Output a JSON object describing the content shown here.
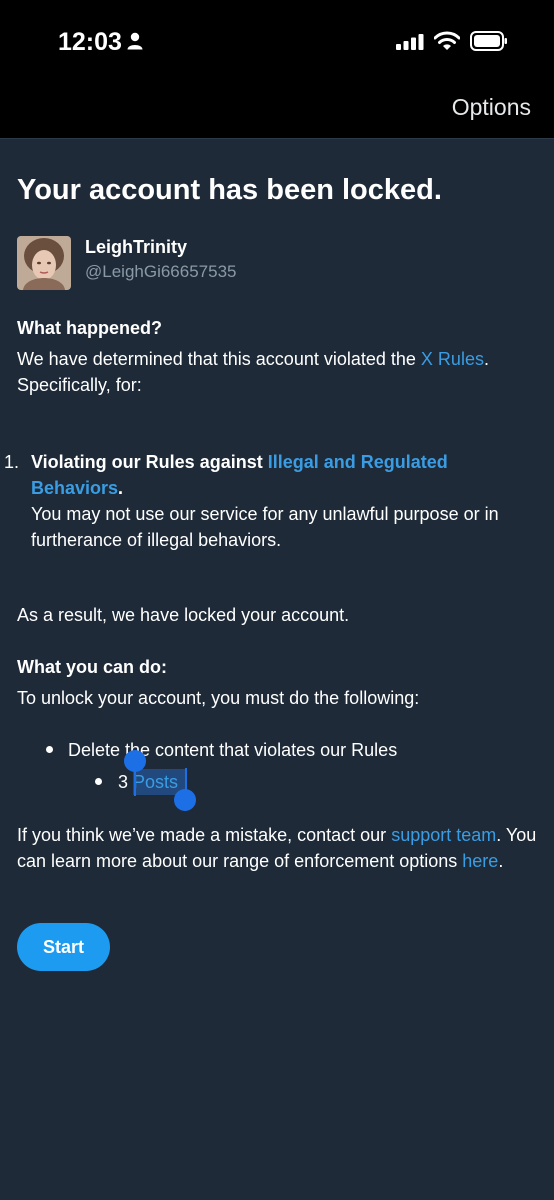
{
  "status_bar": {
    "time": "12:03"
  },
  "top_bar": {
    "options_label": "Options"
  },
  "page": {
    "title": "Your account has been locked.",
    "user": {
      "name": "LeighTrinity",
      "handle": "@LeighGi66657535"
    },
    "what_happened": {
      "heading": "What happened?",
      "text_before_link": "We have determined that this account violated the ",
      "link": "X Rules",
      "text_after_link": ".",
      "text_line2": "Specifically, for:"
    },
    "violation": {
      "number": "1.",
      "lead": "Violating our Rules against ",
      "link": "Illegal and Regulated Behaviors",
      "after_link": ".",
      "description": "You may not use our service for any unlawful purpose or in furtherance of illegal behaviors."
    },
    "result_text": "As a result, we have locked your account.",
    "what_you_can_do": {
      "heading": "What you can do:",
      "text": "To unlock your account, you must do the following:",
      "item": "Delete the content that violates our Rules",
      "subitem_count": "3",
      "subitem_label": "Posts"
    },
    "mistake": {
      "text1": "If you think we’ve made a mistake, contact our ",
      "link1": "support team",
      "text2": ". You can learn more about our range of enforcement options ",
      "link2": "here",
      "text3": "."
    },
    "start_button": "Start"
  }
}
